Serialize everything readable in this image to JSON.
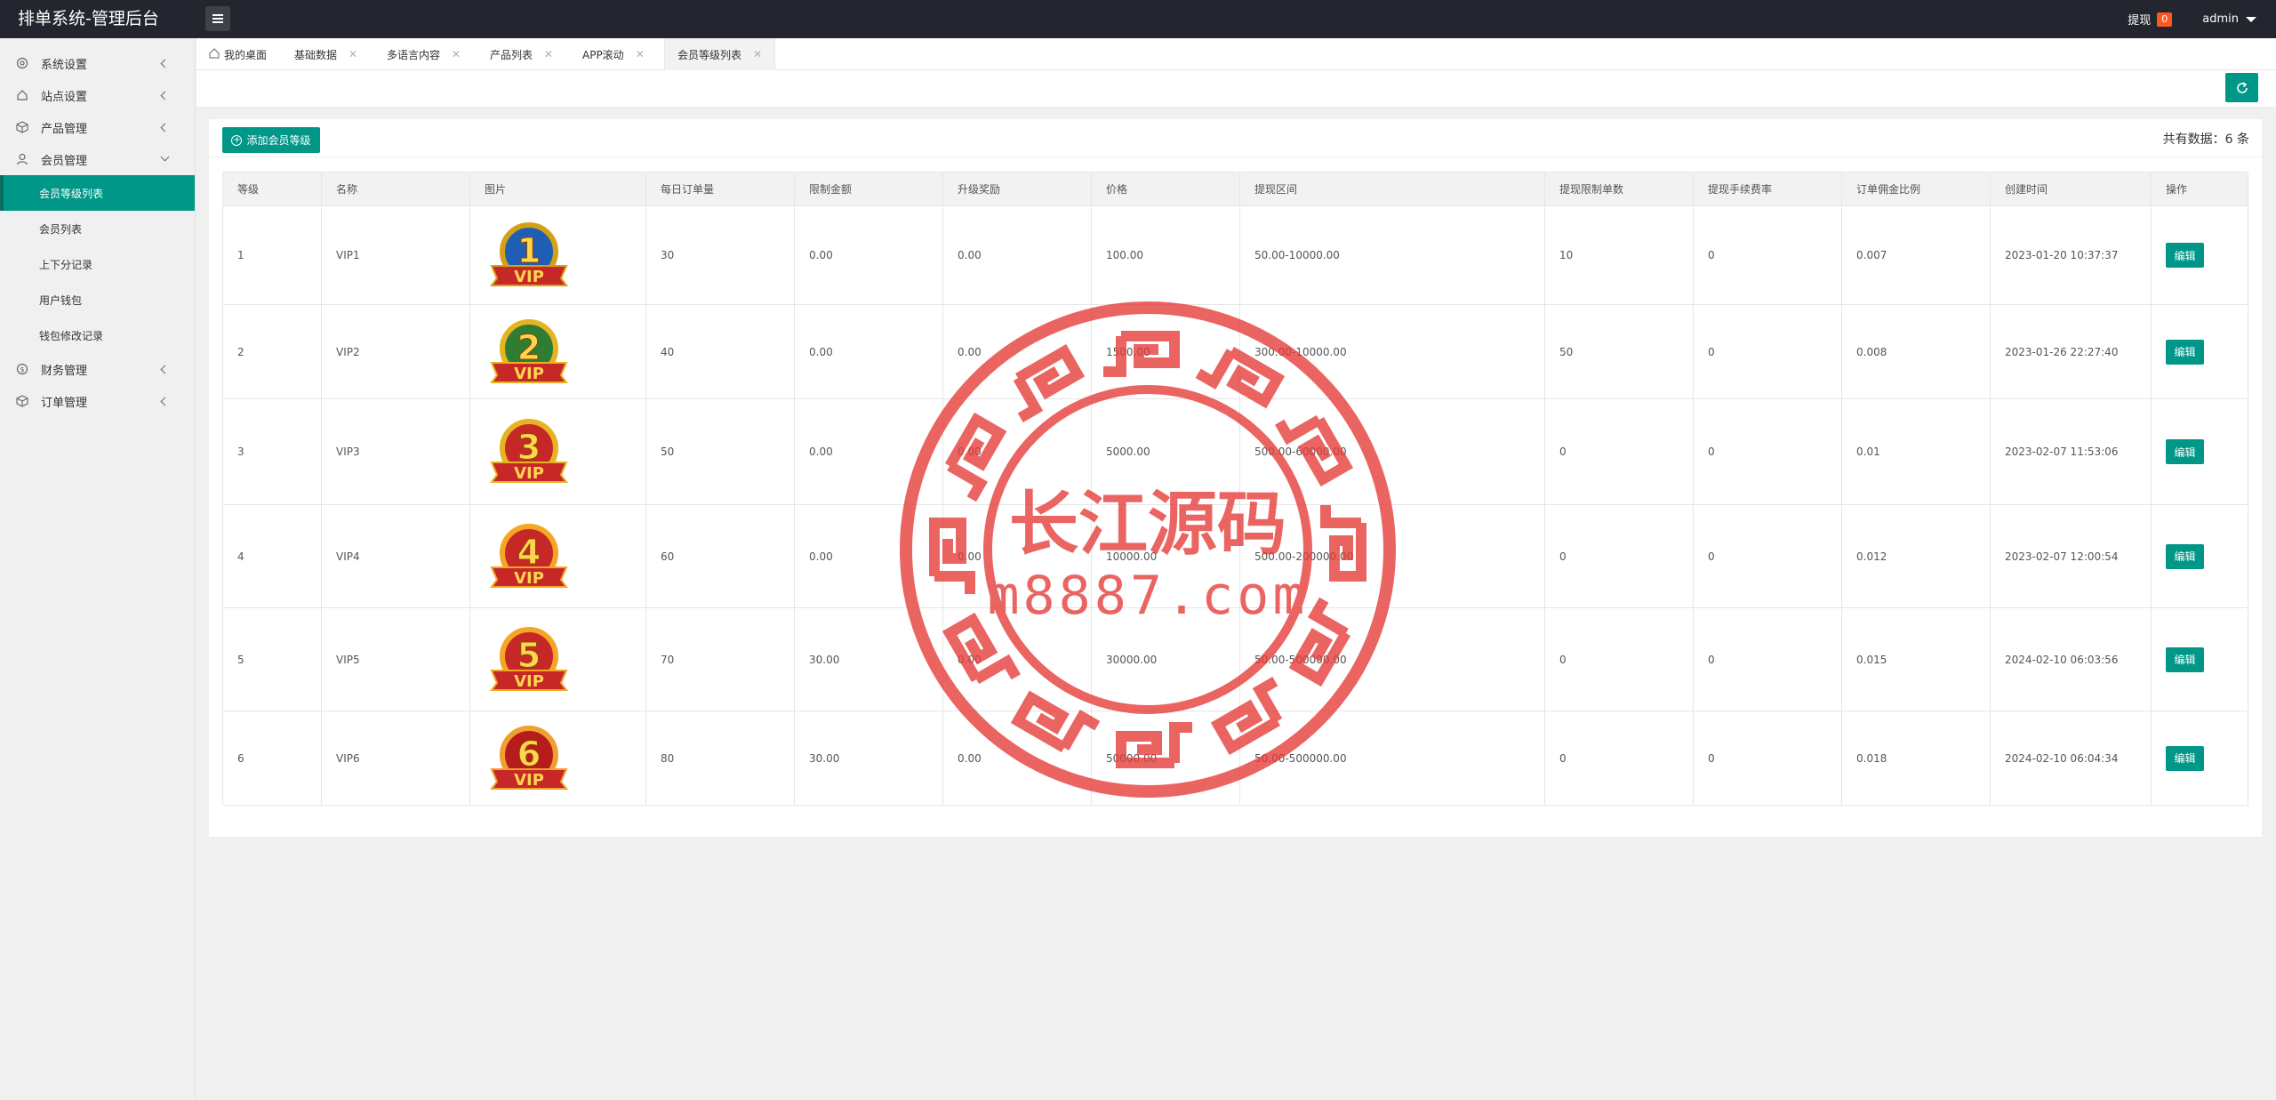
{
  "header": {
    "title": "排单系统-管理后台",
    "withdraw_label": "提现",
    "withdraw_count": "0",
    "user": "admin"
  },
  "sidebar": {
    "items": [
      {
        "label": "系统设置",
        "icon": "gear-icon"
      },
      {
        "label": "站点设置",
        "icon": "home-icon"
      },
      {
        "label": "产品管理",
        "icon": "cube-icon"
      },
      {
        "label": "会员管理",
        "icon": "user-icon"
      }
    ],
    "sub_items": [
      "会员等级列表",
      "会员列表",
      "上下分记录",
      "用户钱包",
      "钱包修改记录"
    ],
    "items_after": [
      {
        "label": "财务管理",
        "icon": "dollar-icon"
      },
      {
        "label": "订单管理",
        "icon": "cube-icon"
      }
    ]
  },
  "tabs": [
    "我的桌面",
    "基础数据",
    "多语言内容",
    "产品列表",
    "APP滚动",
    "会员等级列表"
  ],
  "main": {
    "add_button": "添加会员等级",
    "total_label": "共有数据：6 条",
    "columns": [
      "等级",
      "名称",
      "图片",
      "每日订单量",
      "限制金额",
      "升级奖励",
      "价格",
      "提现区间",
      "提现限制单数",
      "提现手续费率",
      "订单佣金比例",
      "创建时间",
      "操作"
    ],
    "edit_label": "编辑",
    "rows": [
      {
        "level": "1",
        "name": "VIP1",
        "badge": "1",
        "daily": "30",
        "limit": "0.00",
        "reward": "0.00",
        "price": "100.00",
        "range": "50.00-10000.00",
        "withdraw_times": "10",
        "fee": "0",
        "commission": "0.007",
        "created": "2023-01-20 10:37:37"
      },
      {
        "level": "2",
        "name": "VIP2",
        "badge": "2",
        "daily": "40",
        "limit": "0.00",
        "reward": "0.00",
        "price": "1500.00",
        "range": "300.00-10000.00",
        "withdraw_times": "50",
        "fee": "0",
        "commission": "0.008",
        "created": "2023-01-26 22:27:40"
      },
      {
        "level": "3",
        "name": "VIP3",
        "badge": "3",
        "daily": "50",
        "limit": "0.00",
        "reward": "0.00",
        "price": "5000.00",
        "range": "500.00-60000.00",
        "withdraw_times": "0",
        "fee": "0",
        "commission": "0.01",
        "created": "2023-02-07 11:53:06"
      },
      {
        "level": "4",
        "name": "VIP4",
        "badge": "4",
        "daily": "60",
        "limit": "0.00",
        "reward": "0.00",
        "price": "10000.00",
        "range": "500.00-200000.00",
        "withdraw_times": "0",
        "fee": "0",
        "commission": "0.012",
        "created": "2023-02-07 12:00:54"
      },
      {
        "level": "5",
        "name": "VIP5",
        "badge": "5",
        "daily": "70",
        "limit": "30.00",
        "reward": "0.00",
        "price": "30000.00",
        "range": "50.00-500000.00",
        "withdraw_times": "0",
        "fee": "0",
        "commission": "0.015",
        "created": "2024-02-10 06:03:56"
      },
      {
        "level": "6",
        "name": "VIP6",
        "badge": "6",
        "daily": "80",
        "limit": "30.00",
        "reward": "0.00",
        "price": "50000.00",
        "range": "50.00-500000.00",
        "withdraw_times": "0",
        "fee": "0",
        "commission": "0.018",
        "created": "2024-02-10 06:04:34"
      }
    ]
  },
  "watermark": {
    "text": "长江源码",
    "url": "m8887.com"
  },
  "colors": {
    "accent": "#009688",
    "topbar": "#23262e",
    "badge": "#ff5722",
    "watermark": "#e53935"
  }
}
